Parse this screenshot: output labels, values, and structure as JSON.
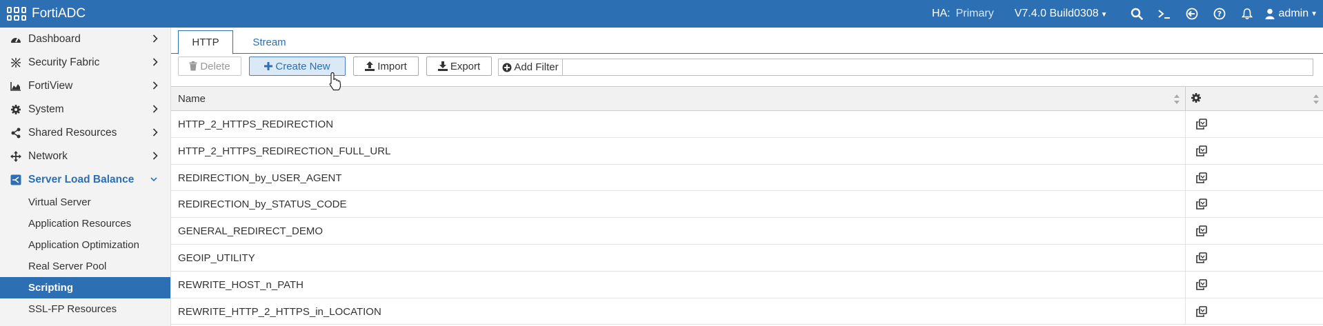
{
  "app": {
    "name": "FortiADC"
  },
  "header": {
    "ha_label": "HA:",
    "ha_value": "Primary",
    "version": "V7.4.0 Build0308",
    "user": "admin"
  },
  "sidebar": {
    "items": [
      {
        "label": "Dashboard"
      },
      {
        "label": "Security Fabric"
      },
      {
        "label": "FortiView"
      },
      {
        "label": "System"
      },
      {
        "label": "Shared Resources"
      },
      {
        "label": "Network"
      },
      {
        "label": "Server Load Balance"
      }
    ],
    "subitems": [
      {
        "label": "Virtual Server"
      },
      {
        "label": "Application Resources"
      },
      {
        "label": "Application Optimization"
      },
      {
        "label": "Real Server Pool"
      },
      {
        "label": "Scripting"
      },
      {
        "label": "SSL-FP Resources"
      }
    ]
  },
  "tabs": [
    {
      "label": "HTTP"
    },
    {
      "label": "Stream"
    }
  ],
  "toolbar": {
    "delete": "Delete",
    "create_new": "Create New",
    "import": "Import",
    "export": "Export",
    "add_filter": "Add Filter"
  },
  "table": {
    "header_name": "Name",
    "rows": [
      "HTTP_2_HTTPS_REDIRECTION",
      "HTTP_2_HTTPS_REDIRECTION_FULL_URL",
      "REDIRECTION_by_USER_AGENT",
      "REDIRECTION_by_STATUS_CODE",
      "GENERAL_REDIRECT_DEMO",
      "GEOIP_UTILITY",
      "REWRITE_HOST_n_PATH",
      "REWRITE_HTTP_2_HTTPS_in_LOCATION"
    ]
  },
  "colors": {
    "accent": "#2d6fb3",
    "selected_bg": "#2d6fb3"
  }
}
